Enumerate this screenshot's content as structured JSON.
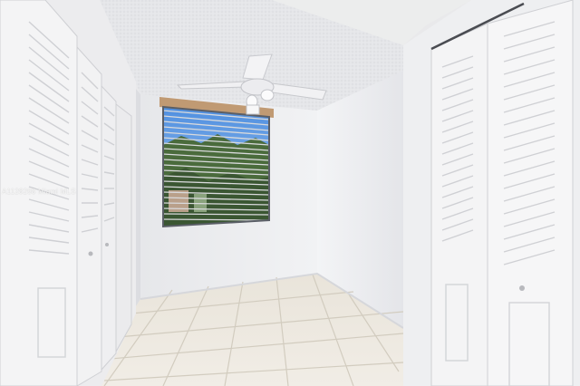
{
  "scene": {
    "description_tags": [
      "ceiling-fan",
      "window-blinds",
      "louvered-closet-doors",
      "tile-floor"
    ],
    "colors": {
      "wall": "#ecedef",
      "wall_shadow": "#d9dbe0",
      "ceiling": "#e6e7ea",
      "floor_tile": "#ece7de",
      "grout": "#d5cfc4",
      "door": "#f4f4f5",
      "trim": "#c9a27a",
      "sky": "#6fa6e4",
      "tree": "#3d5b35"
    }
  },
  "watermark": {
    "text": "A1128288 Miami MLS"
  }
}
